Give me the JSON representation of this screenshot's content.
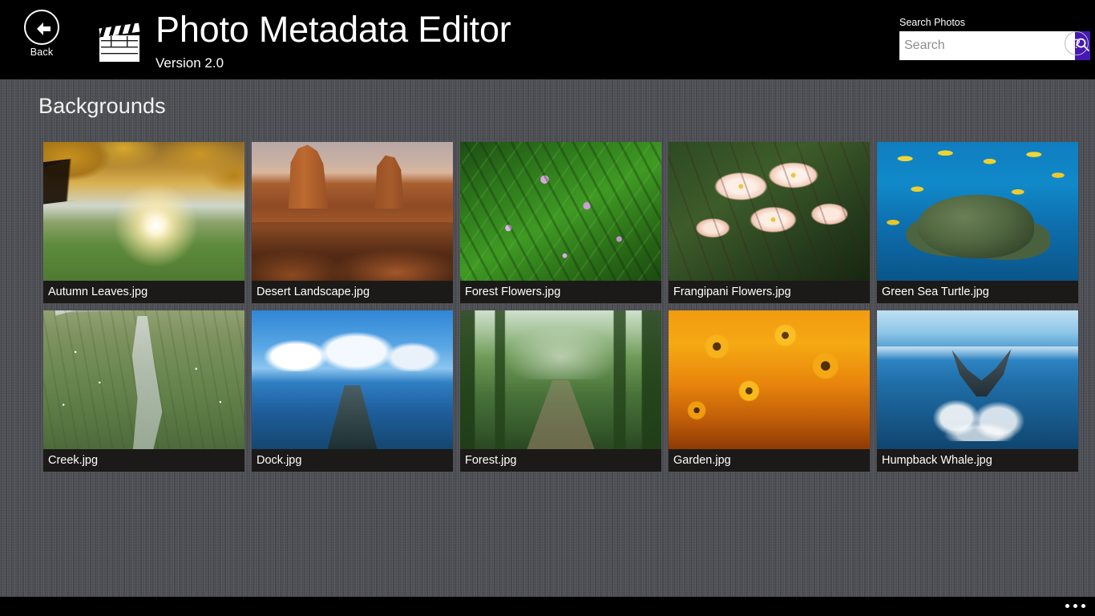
{
  "header": {
    "back": {
      "label": "Back",
      "icon": "back-arrow-icon"
    },
    "app_icon": "clapperboard-icon",
    "title": "Photo Metadata Editor",
    "version": "Version 2.0"
  },
  "search": {
    "label": "Search Photos",
    "value": "",
    "placeholder": "Search",
    "button_icon": "search-icon",
    "accent_color": "#4617b4"
  },
  "help": {
    "label": "?",
    "icon": "help-icon"
  },
  "content": {
    "section_title": "Backgrounds",
    "background_color": "#4b4d52",
    "caption_bar_color": "#1b1a18",
    "photos": [
      {
        "caption": "Autumn Leaves.jpg",
        "art": "ph-autumn"
      },
      {
        "caption": "Desert Landscape.jpg",
        "art": "ph-desert"
      },
      {
        "caption": "Forest Flowers.jpg",
        "art": "ph-forestflowers"
      },
      {
        "caption": "Frangipani Flowers.jpg",
        "art": "ph-frangipani"
      },
      {
        "caption": "Green Sea Turtle.jpg",
        "art": "ph-turtle"
      },
      {
        "caption": "Creek.jpg",
        "art": "ph-creek"
      },
      {
        "caption": "Dock.jpg",
        "art": "ph-dock"
      },
      {
        "caption": "Forest.jpg",
        "art": "ph-forest"
      },
      {
        "caption": "Garden.jpg",
        "art": "ph-garden"
      },
      {
        "caption": "Humpback Whale.jpg",
        "art": "ph-whale"
      }
    ]
  },
  "appbar": {
    "more_icon": "ellipsis-icon",
    "background_color": "#000000"
  }
}
